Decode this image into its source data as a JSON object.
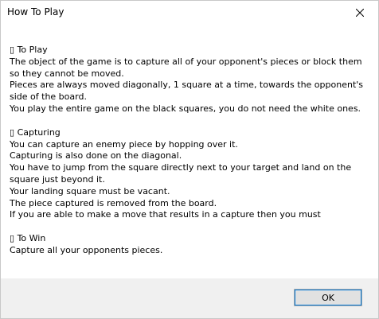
{
  "window": {
    "title": "How To Play",
    "close_icon": "close-icon"
  },
  "sections": [
    {
      "heading_glyph": "▯",
      "heading": "To Play",
      "lines": [
        "The object of the game is to capture all of your opponent's pieces or block them so they cannot be moved.",
        "Pieces are always moved diagonally, 1 square at a time, towards the opponent's side of the board.",
        "You play the entire game on the black squares, you do not need the white ones."
      ]
    },
    {
      "heading_glyph": "▯",
      "heading": "Capturing",
      "lines": [
        "You can capture an enemy piece by hopping over it.",
        "Capturing is also done on the diagonal.",
        "You have to jump from the square directly next to your target and land on the square just beyond it.",
        "Your landing square must be vacant.",
        "The piece captured is removed from the board.",
        "If you are able to make a move that results in a capture then you must"
      ]
    },
    {
      "heading_glyph": "▯",
      "heading": "To Win",
      "lines": [
        "Capture all your opponents pieces."
      ]
    }
  ],
  "footer": {
    "ok_label": "OK"
  }
}
